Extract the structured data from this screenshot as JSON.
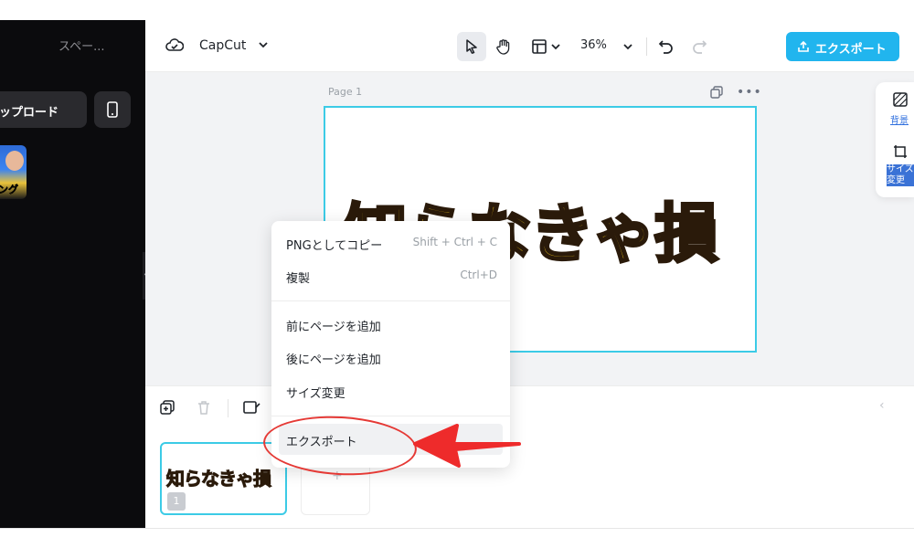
{
  "left_panel": {
    "space_title": "スペー...",
    "upload_label": "アップロード",
    "media_thumb_text": "ング"
  },
  "topbar": {
    "app_name": "CapCut",
    "zoom": "36%",
    "export_label": "エクスポート"
  },
  "canvas": {
    "page_label": "Page 1",
    "artboard_text": "知らなきゃ損"
  },
  "right_panel": {
    "background_label": "背景",
    "resize_label": "サイズ変更"
  },
  "context_menu": {
    "items": [
      {
        "label": "PNGとしてコピー",
        "shortcut": "Shift + Ctrl + C"
      },
      {
        "label": "複製",
        "shortcut": "Ctrl+D"
      },
      {
        "label": "前にページを追加",
        "shortcut": ""
      },
      {
        "label": "後にページを追加",
        "shortcut": ""
      },
      {
        "label": "サイズ変更",
        "shortcut": ""
      },
      {
        "label": "エクスポート",
        "shortcut": ""
      }
    ]
  },
  "pages": {
    "thumbs": [
      {
        "text": "知らなきゃ損",
        "number": "1"
      }
    ],
    "add_slot_symbol": "+"
  },
  "colors": {
    "accent": "#21b5ee",
    "selection": "#3ccbe6",
    "annotation": "#e53935",
    "title_fill": "#ffd31a"
  }
}
